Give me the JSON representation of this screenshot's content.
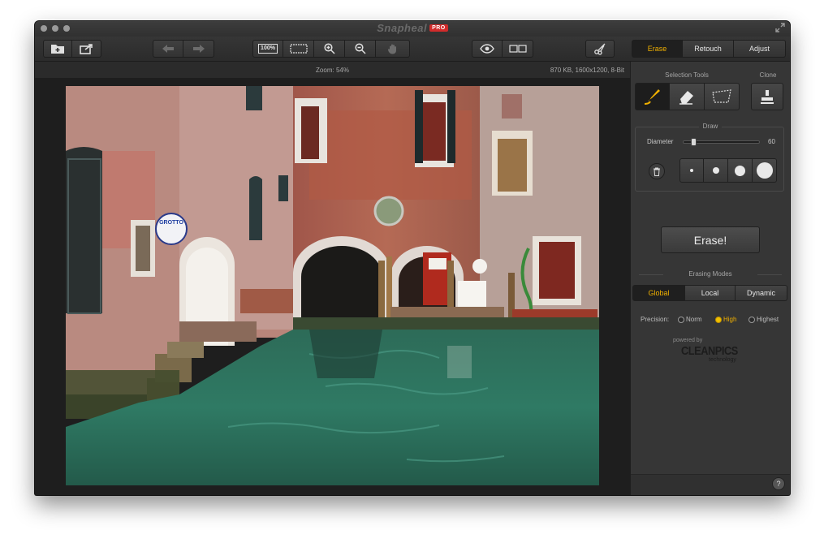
{
  "window": {
    "app_name": "Snapheal",
    "badge": "PRO"
  },
  "toolbar": {
    "zoom_100_label": "100%",
    "icons": [
      "open-image-icon",
      "share-icon",
      "undo-icon",
      "redo-icon",
      "actual-size-icon",
      "fit-screen-icon",
      "zoom-in-icon",
      "zoom-out-icon",
      "hand-icon",
      "preview-eye-icon",
      "compare-icon",
      "crop-icon"
    ]
  },
  "mode_tabs": [
    {
      "label": "Erase",
      "active": true
    },
    {
      "label": "Retouch",
      "active": false
    },
    {
      "label": "Adjust",
      "active": false
    }
  ],
  "infobar": {
    "zoom": "Zoom: 54%",
    "meta": "870 KB, 1600x1200, 8-Bit"
  },
  "panel": {
    "selection_tools_label": "Selection Tools",
    "clone_label": "Clone",
    "draw_label": "Draw",
    "diameter_label": "Diameter",
    "diameter_value": "60",
    "diameter_fraction": 0.1,
    "erase_button": "Erase!",
    "erasing_modes_label": "Erasing Modes",
    "erasing_modes": [
      {
        "label": "Global",
        "active": true
      },
      {
        "label": "Local",
        "active": false
      },
      {
        "label": "Dynamic",
        "active": false
      }
    ],
    "precision_label": "Precision:",
    "precision_options": [
      {
        "label": "Norm",
        "selected": false
      },
      {
        "label": "High",
        "selected": true
      },
      {
        "label": "Highest",
        "selected": false
      }
    ],
    "powered_by": "powered by",
    "brand": "CLEANPICS",
    "brand_sub": "technology",
    "help": "?"
  },
  "photo": {
    "shop_sign_text": "GROTTO"
  },
  "colors": {
    "accent": "#f0b000",
    "window_bg": "#2f2f2f",
    "panel_bg": "#363636"
  }
}
